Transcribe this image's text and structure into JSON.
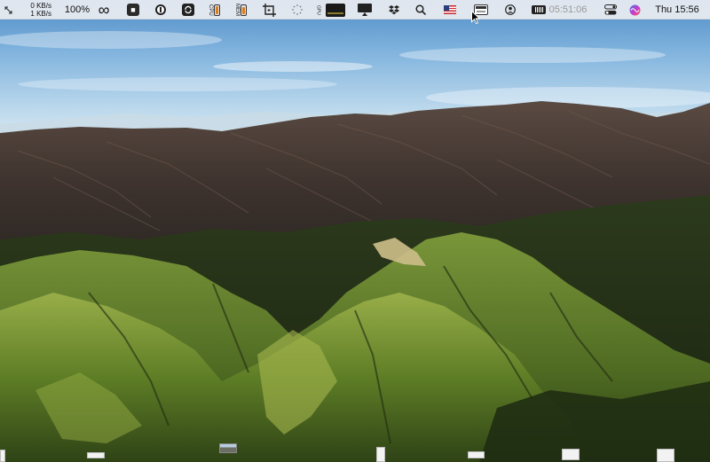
{
  "menubar": {
    "network": {
      "upload": "0 KB/s",
      "download": "1 KB/s"
    },
    "zoom": "100%",
    "cpu_label": "CPU",
    "mem_label": "MEM",
    "time_elapsed": "05:51:06",
    "clock": "Thu 15:56",
    "icons": [
      "arrows-icon",
      "infinity-icon",
      "camera-icon",
      "one-password-icon",
      "sync-icon",
      "cpu-meter-icon",
      "mem-meter-icon",
      "crop-capture-icon",
      "activity-spinner-icon",
      "graph-monitor-icon",
      "display-icon",
      "dropbox-icon",
      "search-icon",
      "us-flag-icon",
      "keyboard-icon",
      "user-icon",
      "battery-icon",
      "control-center-icon",
      "siri-icon"
    ]
  },
  "colors": {
    "menubar_bg": "#eceef2",
    "meter_fill": "#e07b16",
    "sky_top": "#5b93c9",
    "mountain_dark": "#3b2f2a",
    "hill_green": "#5e7d2a"
  }
}
